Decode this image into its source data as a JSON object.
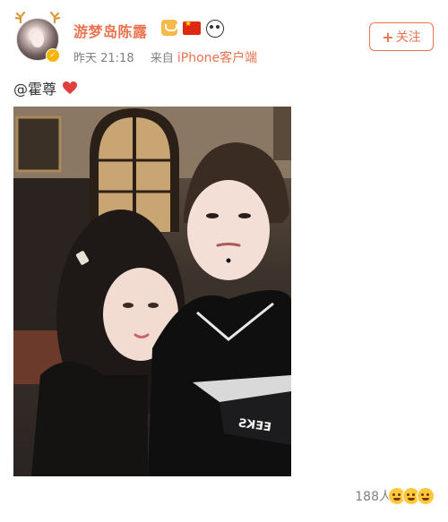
{
  "post": {
    "author": {
      "name": "游梦岛陈露",
      "verified_icon": "verified-badge-icon",
      "badges": [
        "vip-crown-icon",
        "china-flag-icon",
        "panda-icon"
      ]
    },
    "time": "昨天 21:18",
    "source_prefix": "来自",
    "source": "iPhone客户端",
    "follow_label": "关注",
    "text_mention": "@霍尊",
    "emoji": "heart-icon",
    "likes_count": "188人",
    "reaction_icons": [
      "kiss-face-icon",
      "surprised-face-icon",
      "grin-face-icon"
    ],
    "photo_text": "EEKS",
    "colors": {
      "accent": "#eb7350",
      "meta_gray": "#808080",
      "heart": "#e03e3e"
    }
  }
}
